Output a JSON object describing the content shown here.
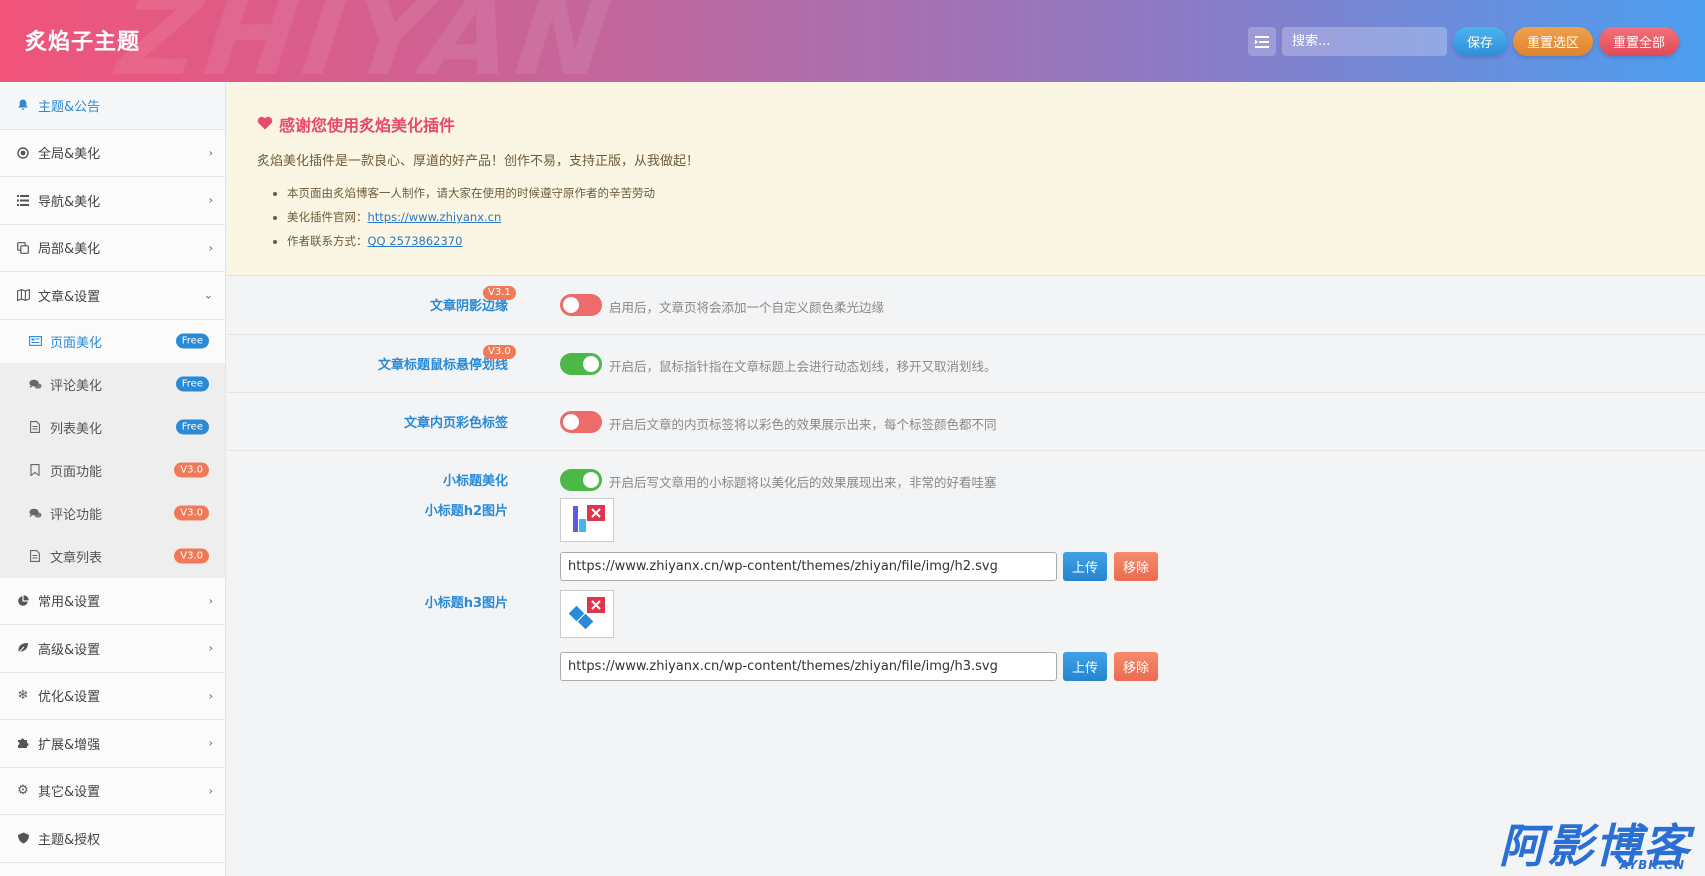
{
  "header": {
    "title": "炙焰子主题",
    "watermark": "ZHIYAN",
    "search_placeholder": "搜索...",
    "save_label": "保存",
    "reset_section_label": "重置选区",
    "reset_all_label": "重置全部"
  },
  "sidebar": {
    "items": [
      {
        "label": "主题&公告",
        "icon": "bell-icon",
        "active": true
      },
      {
        "label": "全局&美化",
        "icon": "target-icon"
      },
      {
        "label": "导航&美化",
        "icon": "list-icon"
      },
      {
        "label": "局部&美化",
        "icon": "copy-icon"
      },
      {
        "label": "文章&设置",
        "icon": "map-icon",
        "expanded": true
      }
    ],
    "subitems": [
      {
        "label": "页面美化",
        "badge": "Free",
        "icon": "image-icon",
        "active": true
      },
      {
        "label": "评论美化",
        "badge": "Free",
        "icon": "comments-icon"
      },
      {
        "label": "列表美化",
        "badge": "Free",
        "icon": "file-icon"
      },
      {
        "label": "页面功能",
        "badge": "V3.0",
        "icon": "bookmark-icon"
      },
      {
        "label": "评论功能",
        "badge": "V3.0",
        "icon": "comments-icon"
      },
      {
        "label": "文章列表",
        "badge": "V3.0",
        "icon": "file-icon"
      }
    ],
    "items_after": [
      {
        "label": "常用&设置",
        "icon": "pie-chart-icon"
      },
      {
        "label": "高级&设置",
        "icon": "leaf-icon"
      },
      {
        "label": "优化&设置",
        "icon": "snowflake-icon"
      },
      {
        "label": "扩展&增强",
        "icon": "puzzle-icon"
      },
      {
        "label": "其它&设置",
        "icon": "gear-icon"
      },
      {
        "label": "主题&授权",
        "icon": "shield-icon"
      }
    ]
  },
  "notice": {
    "title": "感谢您使用炙焰美化插件",
    "desc": "炙焰美化插件是一款良心、厚道的好产品！创作不易，支持正版，从我做起！",
    "line1": "本页面由炙焰博客一人制作，请大家在使用的时候遵守原作者的辛苦劳动",
    "line2_prefix": "美化插件官网：",
    "line2_link": "https://www.zhiyanx.cn",
    "line3_prefix": "作者联系方式：",
    "line3_link": "QQ 2573862370"
  },
  "settings": [
    {
      "label": "文章阴影边缘",
      "tag": "V3.1",
      "on": false,
      "help": "启用后，文章页将会添加一个自定义颜色柔光边缘"
    },
    {
      "label": "文章标题鼠标悬停划线",
      "tag": "V3.0",
      "on": true,
      "help": "开启后，鼠标指针指在文章标题上会进行动态划线，移开又取消划线。"
    },
    {
      "label": "文章内页彩色标签",
      "on": false,
      "help": "开启后文章的内页标签将以彩色的效果展示出来，每个标签颜色都不同"
    },
    {
      "label": "小标题美化",
      "on": true,
      "help": "开启后写文章用的小标题将以美化后的效果展现出来，非常的好看哇塞"
    }
  ],
  "h2": {
    "label": "小标题h2图片",
    "url": "https://www.zhiyanx.cn/wp-content/themes/zhiyan/file/img/h2.svg",
    "upload": "上传",
    "remove": "移除"
  },
  "h3": {
    "label": "小标题h3图片",
    "url": "https://www.zhiyanx.cn/wp-content/themes/zhiyan/file/img/h3.svg",
    "upload": "上传",
    "remove": "移除"
  },
  "brand": {
    "text": "阿影博客",
    "sub": "AYBK.CN"
  },
  "colors": {
    "accent": "#2a8ad6",
    "on": "#4cb848",
    "off": "#ec6b6b",
    "badge_v3": "#f07a58"
  }
}
